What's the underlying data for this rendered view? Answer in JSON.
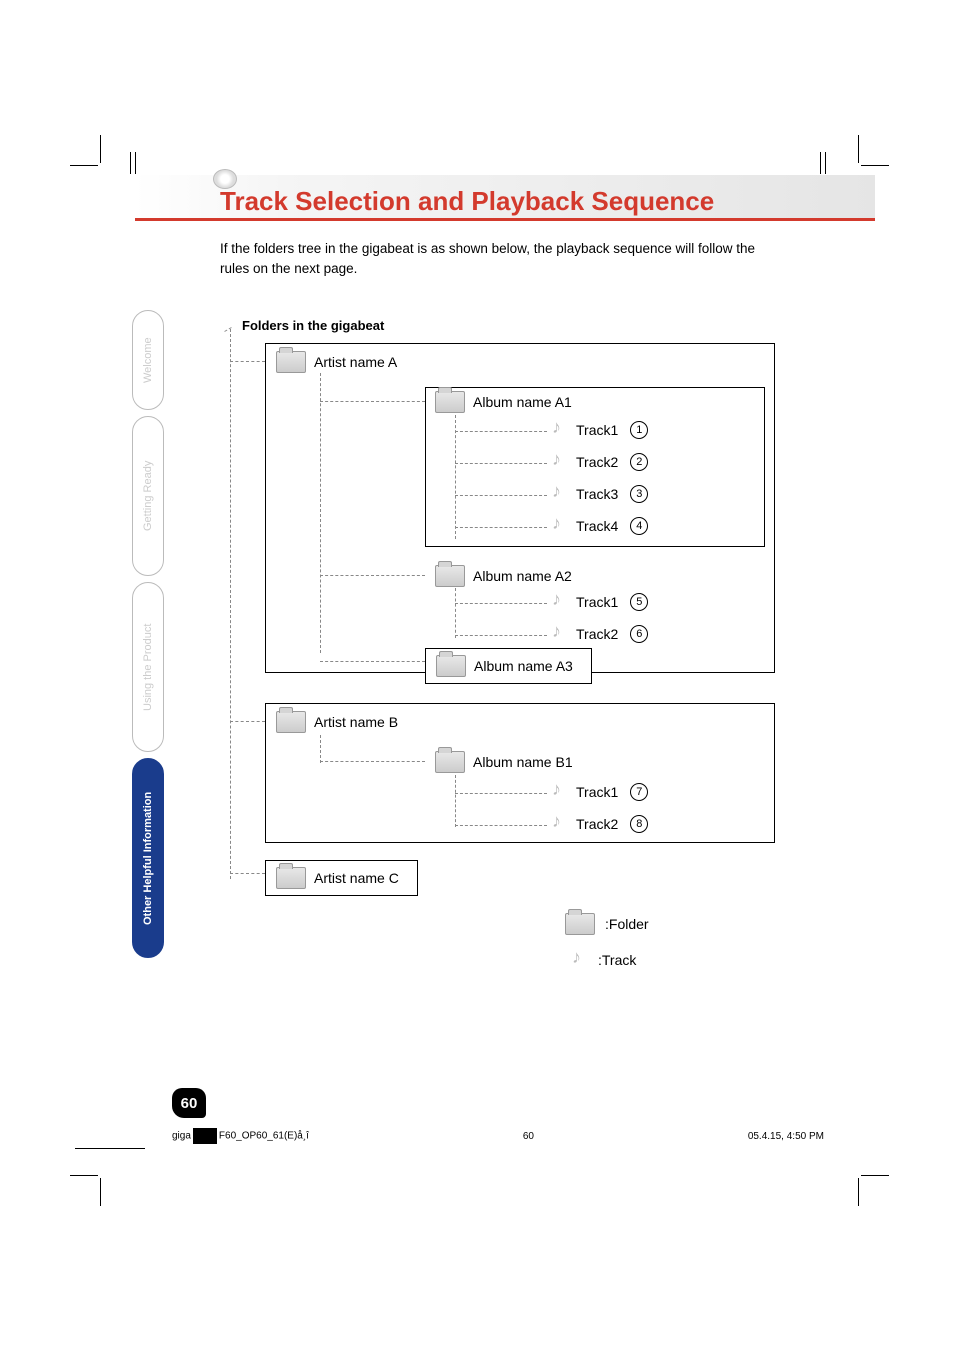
{
  "title": "Track Selection and Playback Sequence",
  "intro": "If the folders tree in the gigabeat is as shown below, the playback sequence will follow the rules on the next page.",
  "diagram_title": "Folders in the gigabeat",
  "side_tabs": [
    {
      "label": "Welcome",
      "active": false
    },
    {
      "label": "Getting Ready",
      "active": false
    },
    {
      "label": "Using the Product",
      "active": false
    },
    {
      "label": "Other Helpful Information",
      "active": true
    }
  ],
  "tree": {
    "artists": [
      {
        "name": "Artist name A",
        "albums": [
          {
            "name": "Album name A1",
            "tracks": [
              {
                "name": "Track1",
                "order": "1"
              },
              {
                "name": "Track2",
                "order": "2"
              },
              {
                "name": "Track3",
                "order": "3"
              },
              {
                "name": "Track4",
                "order": "4"
              }
            ]
          },
          {
            "name": "Album name A2",
            "tracks": [
              {
                "name": "Track1",
                "order": "5"
              },
              {
                "name": "Track2",
                "order": "6"
              }
            ]
          },
          {
            "name": "Album name A3",
            "tracks": []
          }
        ]
      },
      {
        "name": "Artist name B",
        "albums": [
          {
            "name": "Album name B1",
            "tracks": [
              {
                "name": "Track1",
                "order": "7"
              },
              {
                "name": "Track2",
                "order": "8"
              }
            ]
          }
        ]
      },
      {
        "name": "Artist name C",
        "albums": []
      }
    ]
  },
  "legend": {
    "folder": ":Folder",
    "track": ":Track"
  },
  "page_number": "60",
  "footer": {
    "file_left": "giga",
    "file_right": "F60_OP60_61(E)å¸î",
    "center": "60",
    "timestamp": "05.4.15, 4:50 PM"
  }
}
